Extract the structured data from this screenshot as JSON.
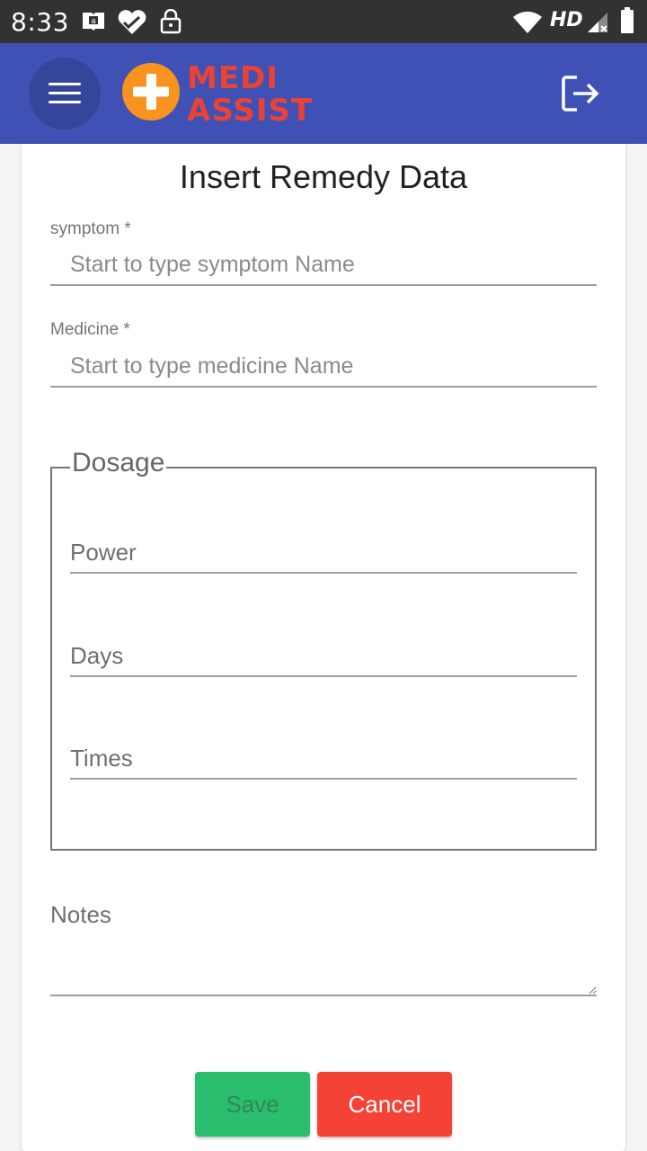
{
  "status_bar": {
    "time": "8:33",
    "network_label": "HD",
    "icons": [
      "amazon-kindle-icon",
      "health-heart-icon",
      "lock-icon",
      "wifi-icon",
      "signal-icon",
      "battery-icon"
    ]
  },
  "app_bar": {
    "logo_line1": "MEDI",
    "logo_line2": "ASSIST",
    "icons": [
      "menu-icon",
      "logout-icon"
    ]
  },
  "form": {
    "title": "Insert Remedy Data",
    "symptom": {
      "label": "symptom *",
      "placeholder": "Start to type symptom Name",
      "value": ""
    },
    "medicine": {
      "label": "Medicine *",
      "placeholder": "Start to type medicine Name",
      "value": ""
    },
    "dosage": {
      "legend": "Dosage",
      "power_placeholder": "Power",
      "days_placeholder": "Days",
      "times_placeholder": "Times"
    },
    "notes_placeholder": "Notes",
    "save_label": "Save",
    "cancel_label": "Cancel"
  },
  "colors": {
    "app_bar": "#3f51b5",
    "logo_orange": "#f7931e",
    "logo_red": "#ea4335",
    "save_green": "#2bbd6e",
    "cancel_red": "#f44336"
  }
}
